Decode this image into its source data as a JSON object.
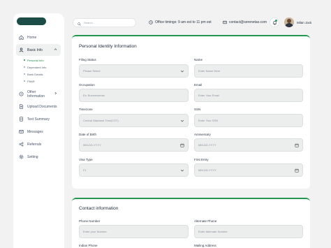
{
  "sidebar": {
    "items": [
      {
        "label": "Home",
        "icon": "home-icon"
      },
      {
        "label": "Basic Info",
        "icon": "user-icon",
        "active": true,
        "expanded": true
      },
      {
        "label": "Other Information",
        "icon": "info-icon"
      },
      {
        "label": "Upload Documents",
        "icon": "upload-icon"
      },
      {
        "label": "Text Summary",
        "icon": "document-icon"
      },
      {
        "label": "Messages",
        "icon": "message-icon"
      },
      {
        "label": "Referrals",
        "icon": "share-icon"
      },
      {
        "label": "Setting",
        "icon": "gear-icon"
      }
    ],
    "sub_items": [
      {
        "label": "Personal Info",
        "active": true
      },
      {
        "label": "Dependent Info"
      },
      {
        "label": "Bank Details"
      },
      {
        "label": "FBAR"
      }
    ]
  },
  "header": {
    "search_placeholder": "Search...",
    "office_timings": "Office timings: 9 am est to 11 pm est",
    "email": "contact@serenetax.com",
    "username": "Milan Jack"
  },
  "personal": {
    "title": "Personal Identity Information",
    "fields": {
      "filing_status": {
        "label": "Filing Status",
        "placeholder": "Please Select"
      },
      "name": {
        "label": "Name",
        "placeholder": "Enter Name Here"
      },
      "occupation": {
        "label": "Occupation",
        "placeholder": "Ex: Businessman"
      },
      "email": {
        "label": "Email",
        "placeholder": "Enter Your Email"
      },
      "timezone": {
        "label": "Timezone",
        "placeholder": "Central Standard Time(CST)"
      },
      "ssn": {
        "label": "SSN",
        "placeholder": "Enter Your SSN"
      },
      "dob": {
        "label": "Date of Birth",
        "placeholder": "MM-DD-YYYY"
      },
      "anniversary": {
        "label": "Anniversary",
        "placeholder": "MM-DD-YYYY"
      },
      "visa_type": {
        "label": "Visa Type",
        "placeholder": "F1"
      },
      "first_entry": {
        "label": "First Entry",
        "placeholder": "MM-DD-YYYY"
      }
    }
  },
  "contact": {
    "title": "Contact information",
    "fields": {
      "phone": {
        "label": "Phone Number",
        "placeholder": "Enter your Number"
      },
      "alt_phone": {
        "label": "Alternate Phone",
        "placeholder": "Enter Alternate Number"
      },
      "indian_phone": {
        "label": "Indian Phone"
      },
      "mailing_address": {
        "label": "Mailing Address"
      }
    }
  },
  "colors": {
    "accent": "#23964f",
    "logo": "#1b4d46",
    "background": "#f1f2f1"
  }
}
